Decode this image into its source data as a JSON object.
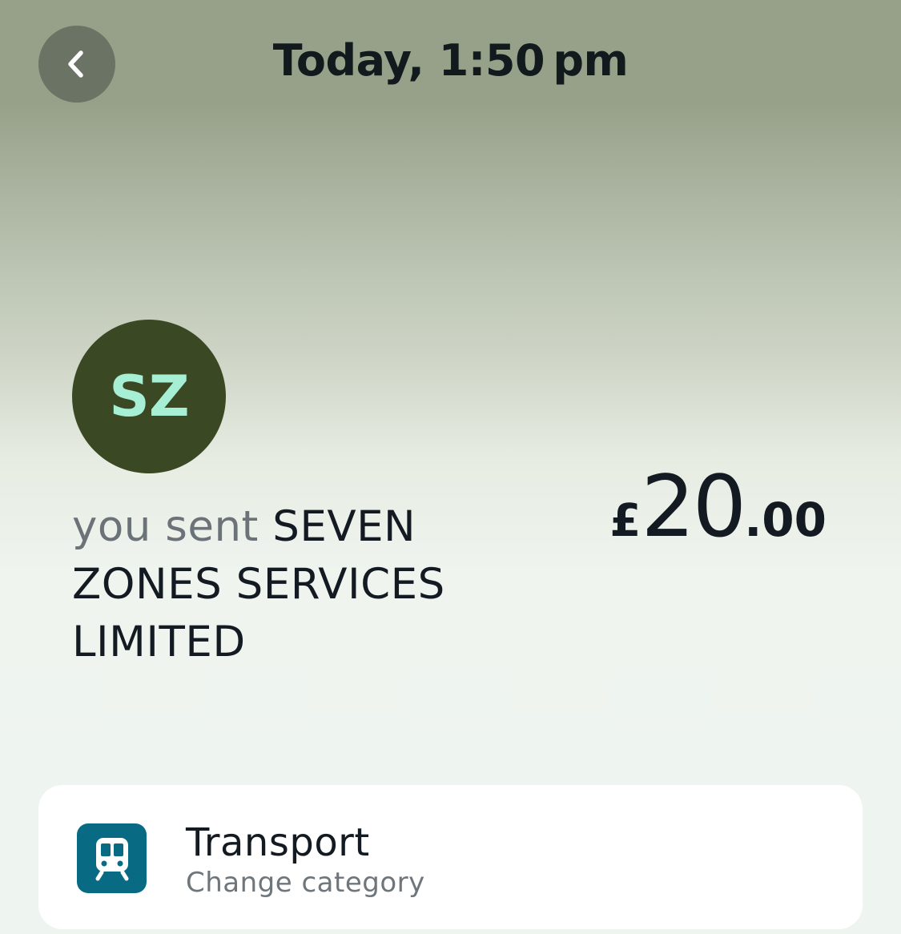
{
  "header": {
    "title": "Today, 1:50 pm",
    "back_icon": "chevron-left-icon"
  },
  "payee": {
    "initials": "SZ",
    "avatar_bg": "#3a4823",
    "initials_color": "#a6efd5"
  },
  "transaction": {
    "prefix": "you sent",
    "payee_name": "SEVEN ZONES SERVICES LIMITED",
    "amount": {
      "currency": "£",
      "whole": "20",
      "decimal": ".00"
    }
  },
  "category": {
    "name": "Transport",
    "action": "Change category",
    "icon": "train-icon",
    "icon_bg": "#096a84"
  }
}
